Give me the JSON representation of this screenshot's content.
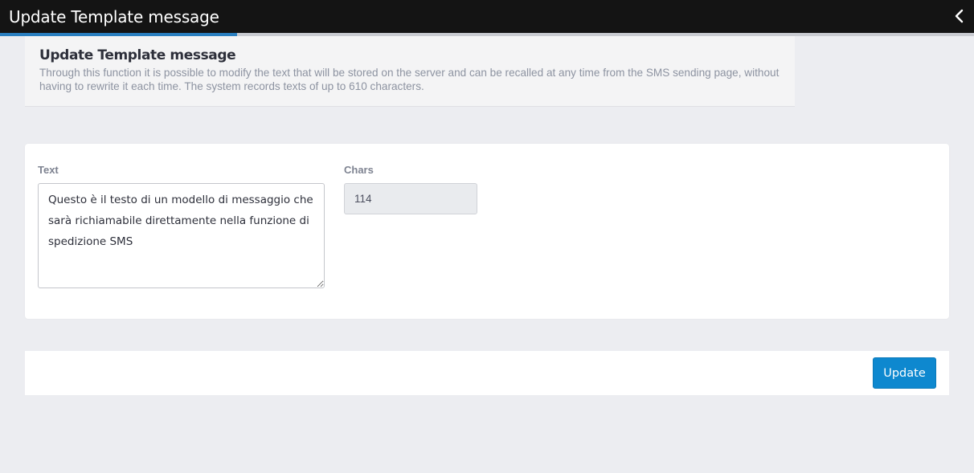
{
  "header": {
    "title": "Update Template message",
    "back_icon": "chevron-left-icon",
    "progress_percent": 24.3,
    "progress_color": "#2a7fc0",
    "background_color": "#141414"
  },
  "info": {
    "title": "Update Template message",
    "description": "Through this function it is possible to modify the text that will be stored on the server and can be recalled at any time from the SMS sending page, without having to rewrite it each time. The system records texts of up to 610 characters."
  },
  "form": {
    "text_label": "Text",
    "text_value": "Questo è il testo di un modello di messaggio che sarà richiamabile direttamente nella funzione di spedizione SMS",
    "chars_label": "Chars",
    "chars_value": "114"
  },
  "actions": {
    "update_label": "Update",
    "update_color": "#0e88cf"
  }
}
